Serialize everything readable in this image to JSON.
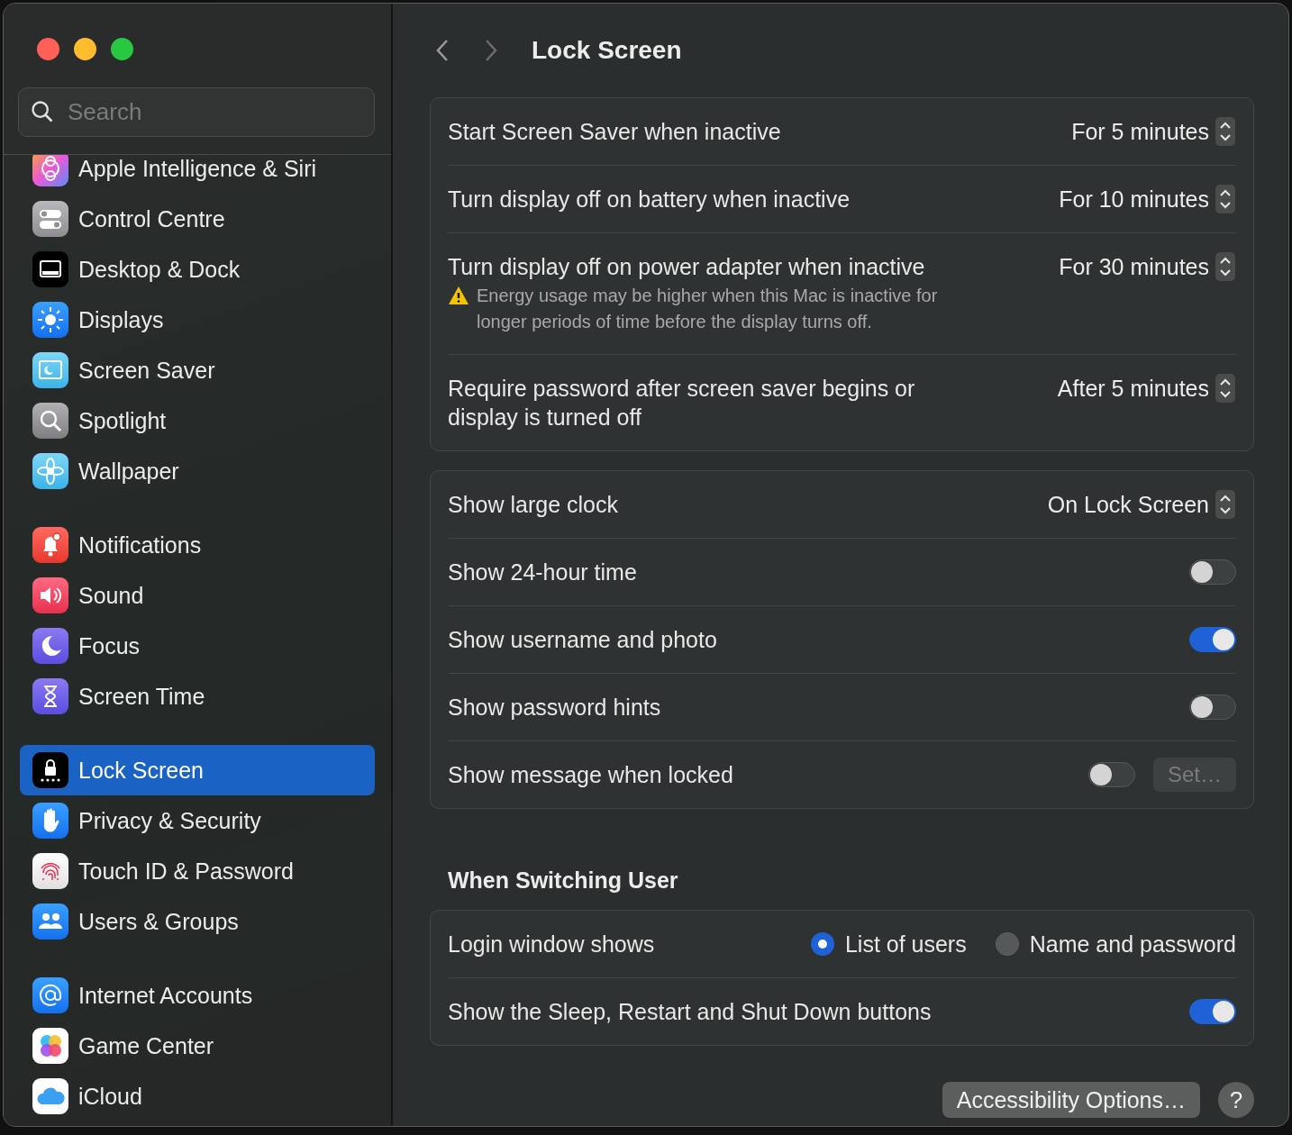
{
  "title": "Lock Screen",
  "search": {
    "placeholder": "Search"
  },
  "sidebar": {
    "groups": [
      {
        "items": [
          {
            "label": "Apple Intelligence & Siri",
            "selected": false
          },
          {
            "label": "Control Centre",
            "selected": false
          },
          {
            "label": "Desktop & Dock",
            "selected": false
          },
          {
            "label": "Displays",
            "selected": false
          },
          {
            "label": "Screen Saver",
            "selected": false
          },
          {
            "label": "Spotlight",
            "selected": false
          },
          {
            "label": "Wallpaper",
            "selected": false
          }
        ]
      },
      {
        "items": [
          {
            "label": "Notifications",
            "selected": false
          },
          {
            "label": "Sound",
            "selected": false
          },
          {
            "label": "Focus",
            "selected": false
          },
          {
            "label": "Screen Time",
            "selected": false
          }
        ]
      },
      {
        "items": [
          {
            "label": "Lock Screen",
            "selected": true
          },
          {
            "label": "Privacy & Security",
            "selected": false
          },
          {
            "label": "Touch ID & Password",
            "selected": false
          },
          {
            "label": "Users & Groups",
            "selected": false
          }
        ]
      },
      {
        "items": [
          {
            "label": "Internet Accounts",
            "selected": false
          },
          {
            "label": "Game Center",
            "selected": false
          },
          {
            "label": "iCloud",
            "selected": false
          }
        ]
      }
    ]
  },
  "sections": [
    {
      "rows": [
        {
          "kind": "popup",
          "label": "Start Screen Saver when inactive",
          "value": "For 5 minutes"
        },
        {
          "kind": "popup",
          "label": "Turn display off on battery when inactive",
          "value": "For 10 minutes"
        },
        {
          "kind": "popup",
          "label": "Turn display off on power adapter when inactive",
          "note": "Energy usage may be higher when this Mac is inactive for longer periods of time before the display turns off.",
          "value": "For 30 minutes"
        },
        {
          "kind": "popup",
          "label": "Require password after screen saver begins or display is turned off",
          "value": "After 5 minutes"
        }
      ]
    },
    {
      "rows": [
        {
          "kind": "popup",
          "label": "Show large clock",
          "value": "On Lock Screen"
        },
        {
          "kind": "toggle",
          "label": "Show 24-hour time",
          "on": false
        },
        {
          "kind": "toggle",
          "label": "Show username and photo",
          "on": true
        },
        {
          "kind": "toggle",
          "label": "Show password hints",
          "on": false
        },
        {
          "kind": "toggle",
          "label": "Show message when locked",
          "on": false,
          "button": {
            "label": "Set…",
            "disabled": true
          }
        }
      ]
    },
    {
      "heading": "When Switching User",
      "rows": [
        {
          "kind": "radio",
          "label": "Login window shows",
          "options": [
            {
              "label": "List of users",
              "selected": true
            },
            {
              "label": "Name and password",
              "selected": false
            }
          ]
        },
        {
          "kind": "toggle",
          "label": "Show the Sleep, Restart and Shut Down buttons",
          "on": true
        }
      ]
    }
  ],
  "footer": {
    "button": "Accessibility Options…",
    "help": "?"
  }
}
